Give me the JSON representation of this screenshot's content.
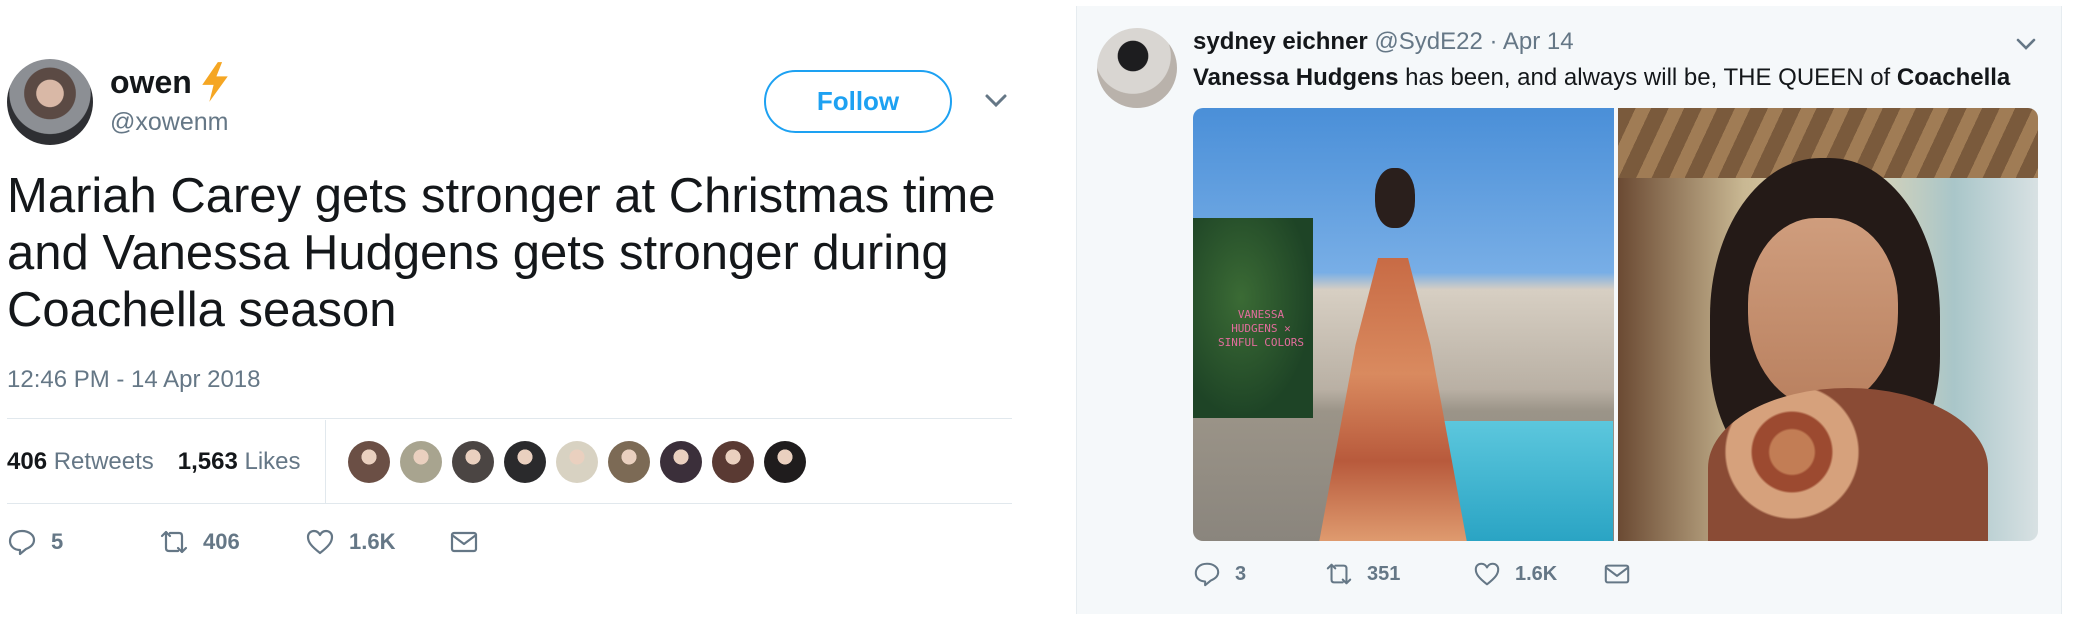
{
  "left_tweet": {
    "author": {
      "name": "owen",
      "handle": "@xowenm",
      "badge_icon": "lightning-bolt-icon"
    },
    "follow_label": "Follow",
    "text_lines": [
      "Mariah Carey gets stronger at Christmas time",
      "and Vanessa Hudgens gets stronger during",
      "Coachella season"
    ],
    "timestamp": "12:46 PM - 14 Apr 2018",
    "stats": {
      "retweets_count": "406",
      "retweets_label": "Retweets",
      "likes_count": "1,563",
      "likes_label": "Likes"
    },
    "liker_avatar_colors": [
      "#6b4f45",
      "#a8a48f",
      "#4b4543",
      "#2a2a2c",
      "#d8d2c2",
      "#7c6a55",
      "#3b2f3a",
      "#5a3a33",
      "#1f1c1d"
    ],
    "actions": {
      "replies": "5",
      "retweets": "406",
      "likes": "1.6K"
    }
  },
  "right_tweet": {
    "author": {
      "name": "sydney eichner",
      "handle": "@SydE22",
      "separator": "·",
      "date": "Apr 14"
    },
    "text": {
      "part1": "Vanessa Hudgens",
      "part2": " has been, and always will be, THE QUEEN of ",
      "part3": "Coachella"
    },
    "photo1_sign_text": "VANESSA HUDGENS ✕ SINFUL COLORS",
    "actions": {
      "replies": "3",
      "retweets": "351",
      "likes": "1.6K"
    }
  },
  "colors": {
    "accent": "#1da1f2",
    "secondary_text": "#657786",
    "primary_text": "#14171a",
    "bolt": "#f5a623"
  }
}
